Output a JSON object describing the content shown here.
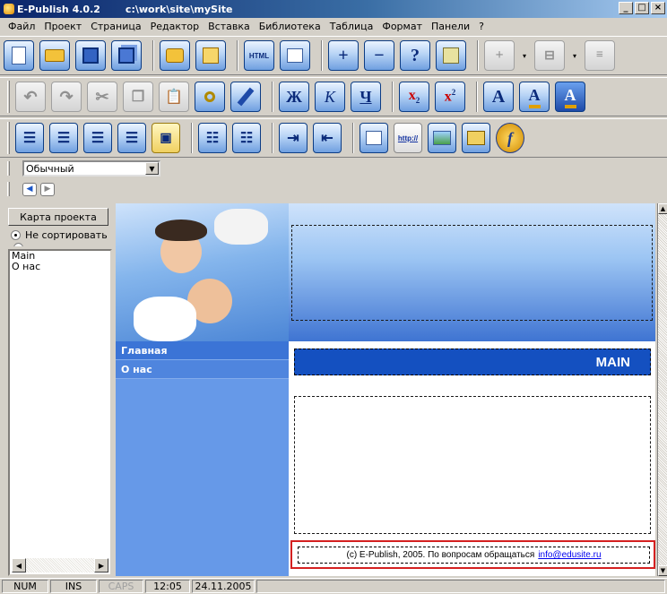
{
  "window": {
    "app_title": "E-Publish 4.0.2",
    "path": "c:\\work\\site\\mySite",
    "minimize_glyph": "_",
    "maximize_glyph": "□",
    "close_glyph": "×",
    "icon": "app-logo-icon"
  },
  "menu": [
    "Файл",
    "Проект",
    "Страница",
    "Редактор",
    "Вставка",
    "Библиотека",
    "Таблица",
    "Формат",
    "Панели",
    "?"
  ],
  "toolbar_icons": {
    "row1": [
      "new-page-icon",
      "open-folder-icon",
      "save-icon",
      "save-all-icon",
      "publish-icon",
      "insert-page-icon",
      "html-export-icon",
      "insert-image-icon",
      "add-page-icon",
      "remove-page-icon",
      "help-icon",
      "properties-icon",
      "add-column-icon",
      "split-column-icon",
      "more-icon"
    ],
    "row2": [
      "undo-icon",
      "redo-icon",
      "cut-icon",
      "copy-icon",
      "paste-icon",
      "find-icon",
      "clear-format-icon",
      "bold-icon",
      "italic-icon",
      "underline-icon",
      "subscript-icon",
      "superscript-icon",
      "font-icon",
      "font-color-icon",
      "highlight-color-icon"
    ],
    "row3": [
      "align-left-icon",
      "align-center-icon",
      "align-right-icon",
      "align-justify-icon",
      "clear-block-icon",
      "bulleted-list-icon",
      "numbered-list-icon",
      "indent-icon",
      "outdent-icon",
      "edit-text-icon",
      "hyperlink-icon",
      "insert-picture-icon",
      "insert-table-icon",
      "flash-icon"
    ]
  },
  "toolbar_labels": {
    "html": "HTML",
    "bold": "Ж",
    "italic": "К",
    "underline": "Ч",
    "subscript": "x",
    "subscript_mark": "2",
    "superscript": "x",
    "superscript_mark": "2",
    "font": "A",
    "link": "http://",
    "flash": "f"
  },
  "style_select": {
    "value": "Обычный"
  },
  "left_panel": {
    "sitemap_button": "Карта проекта",
    "sort_option": "Не сортировать",
    "pages": [
      "Main",
      "О нас"
    ]
  },
  "page_preview": {
    "nav_links": [
      "Главная",
      "О нас"
    ],
    "main_heading": "MAIN",
    "footer_text": "(c) E-Publish, 2005. По вопросам обращаться",
    "footer_email": "info@edusite.ru"
  },
  "statusbar": {
    "num": "NUM",
    "ins": "INS",
    "caps": "CAPS",
    "time": "12:05",
    "date": "24.11.2005"
  },
  "colors": {
    "titlebar": "#0a246a",
    "chrome": "#d4d0c8",
    "nav_column": "#6699e8",
    "main_heading_bg": "#1450c0",
    "footer_highlight": "#d42020",
    "link": "#0000ee"
  }
}
